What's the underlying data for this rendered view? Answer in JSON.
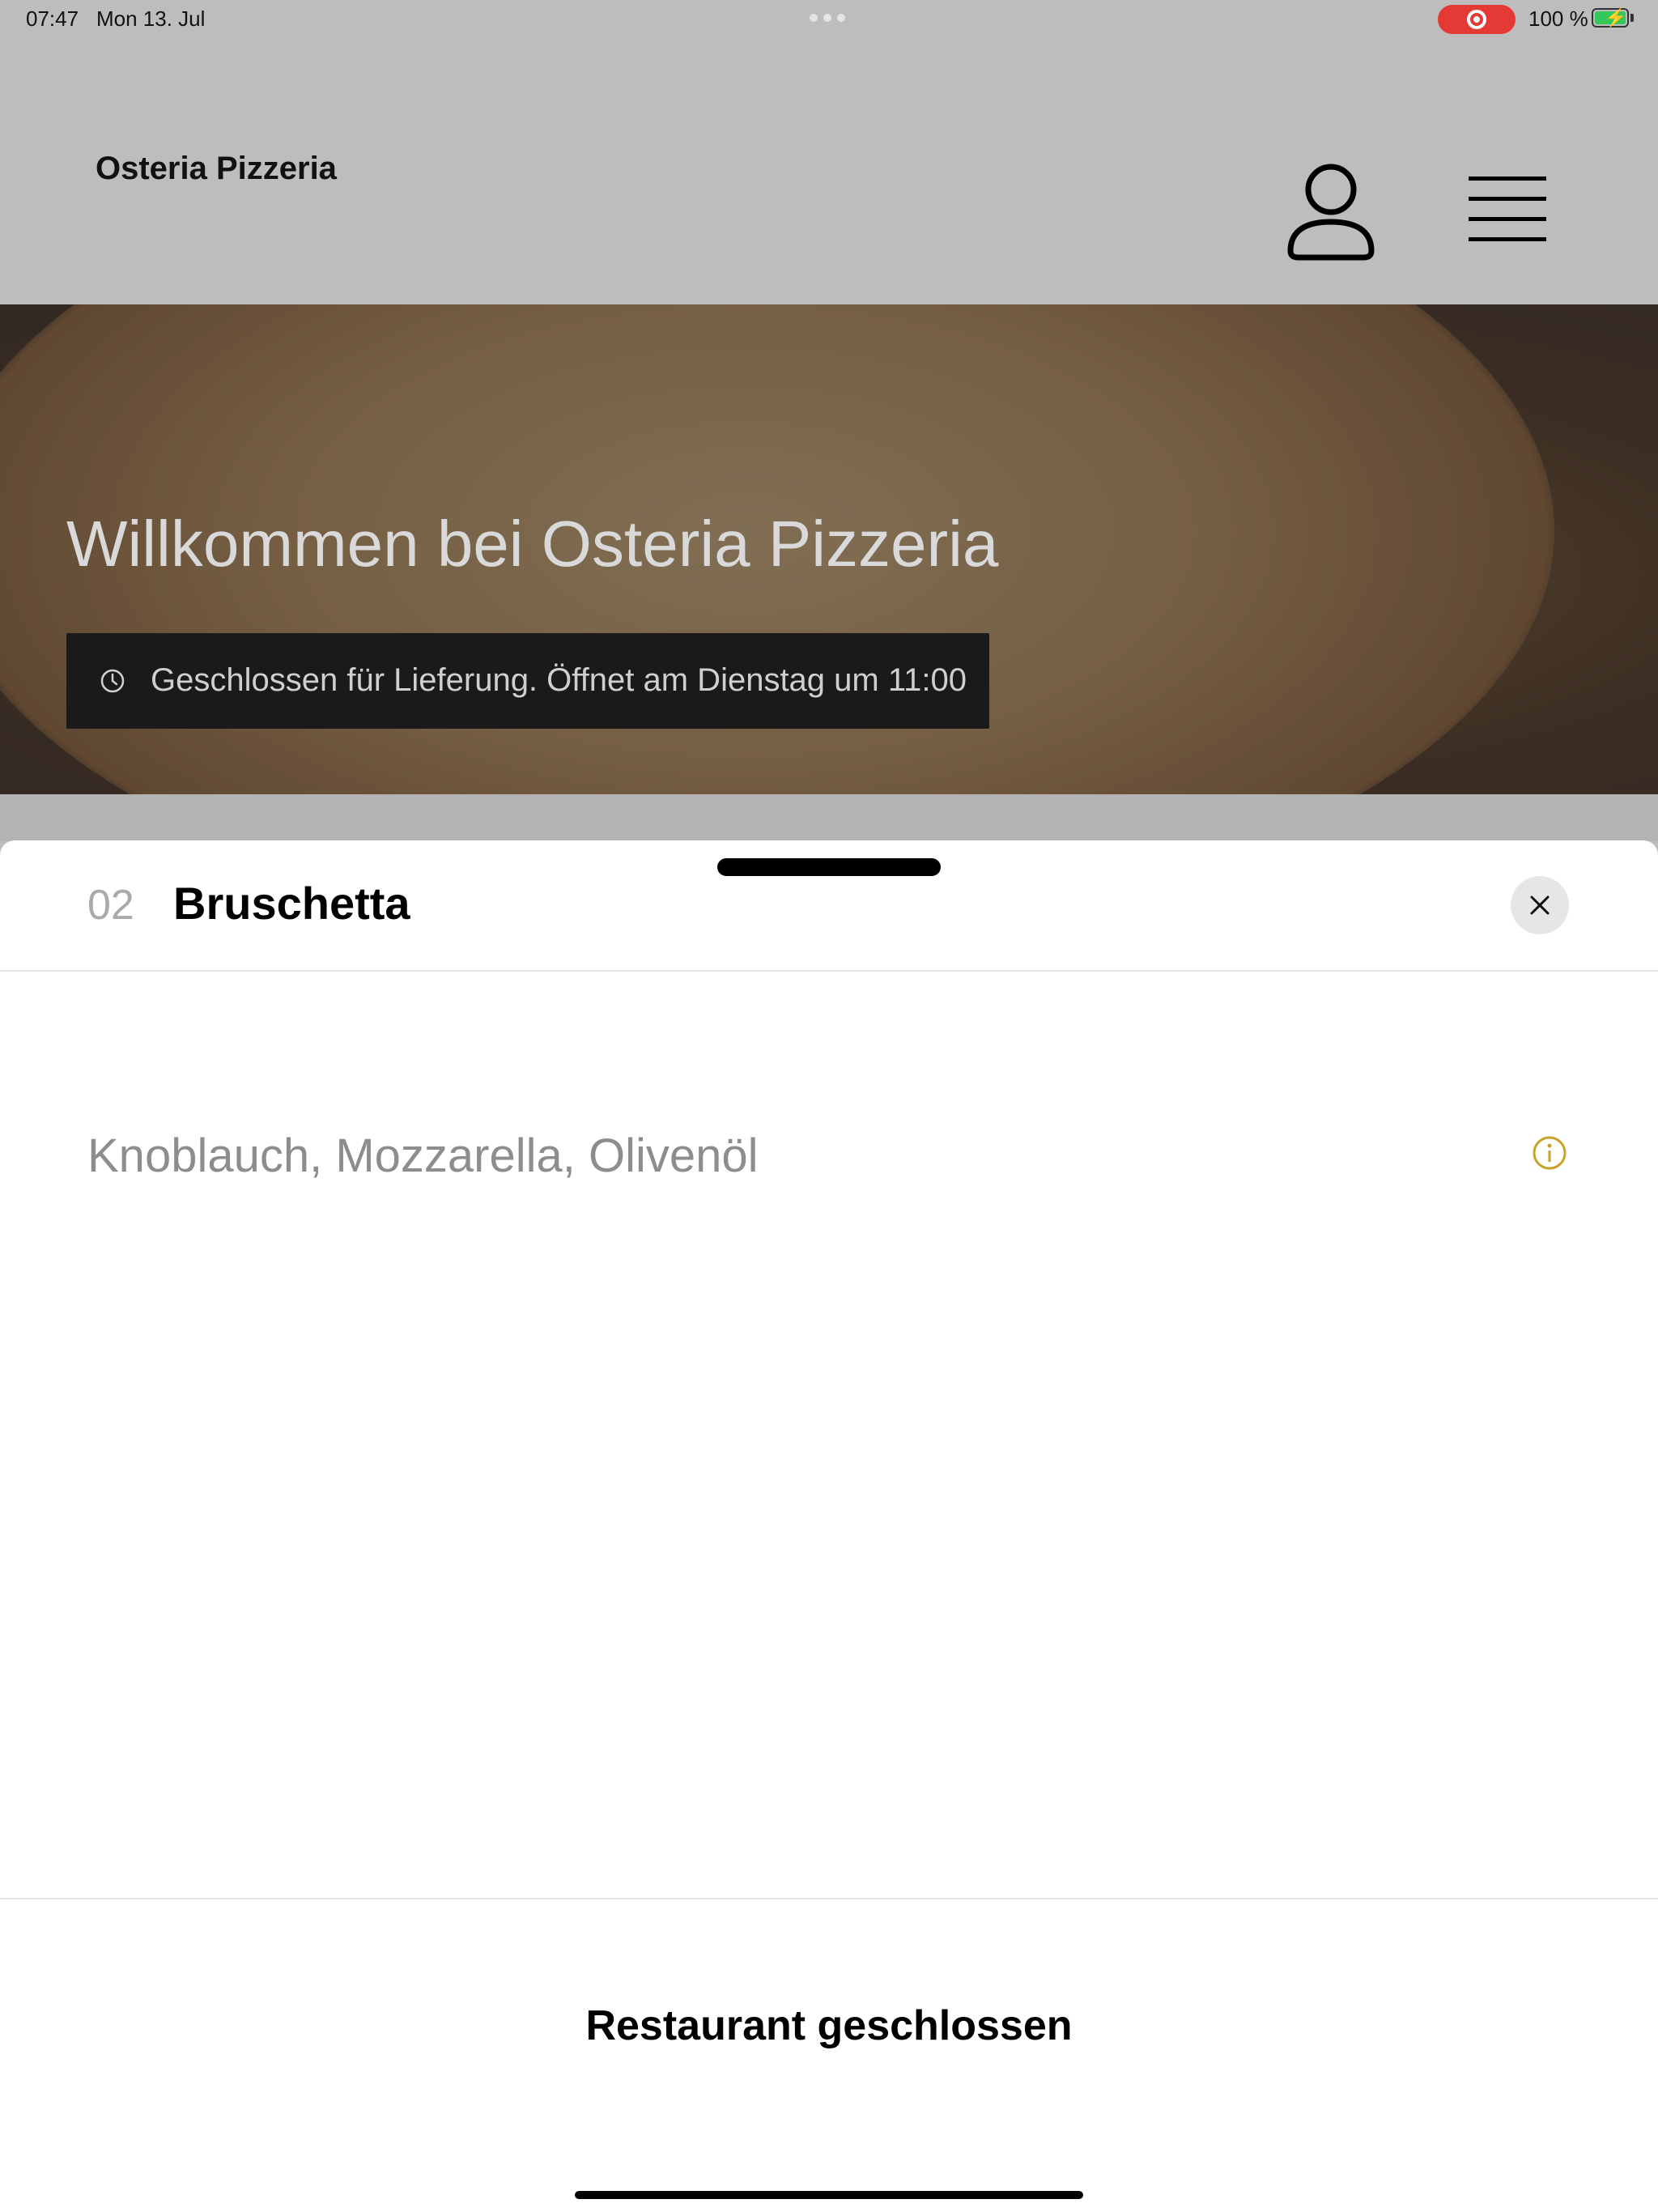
{
  "status_bar": {
    "time": "07:47",
    "date": "Mon 13. Jul",
    "battery_percent": "100 %",
    "battery_level": 1.0,
    "recording_color": "#e53935"
  },
  "header": {
    "brand": "Osteria Pizzeria",
    "icons": [
      "user-icon",
      "menu-icon"
    ]
  },
  "hero": {
    "title": "Willkommen bei Osteria Pizzeria",
    "notice": "Geschlossen für Lieferung. Öffnet am Dienstag um 11:00",
    "notice_icon": "clock-icon"
  },
  "item_sheet": {
    "number": "02",
    "title": "Bruschetta",
    "ingredients": "Knoblauch, Mozzarella, Olivenöl",
    "close_icon": "close-icon",
    "info_icon": "info-icon",
    "info_color": "#c9a227",
    "status_button": "Restaurant geschlossen"
  }
}
